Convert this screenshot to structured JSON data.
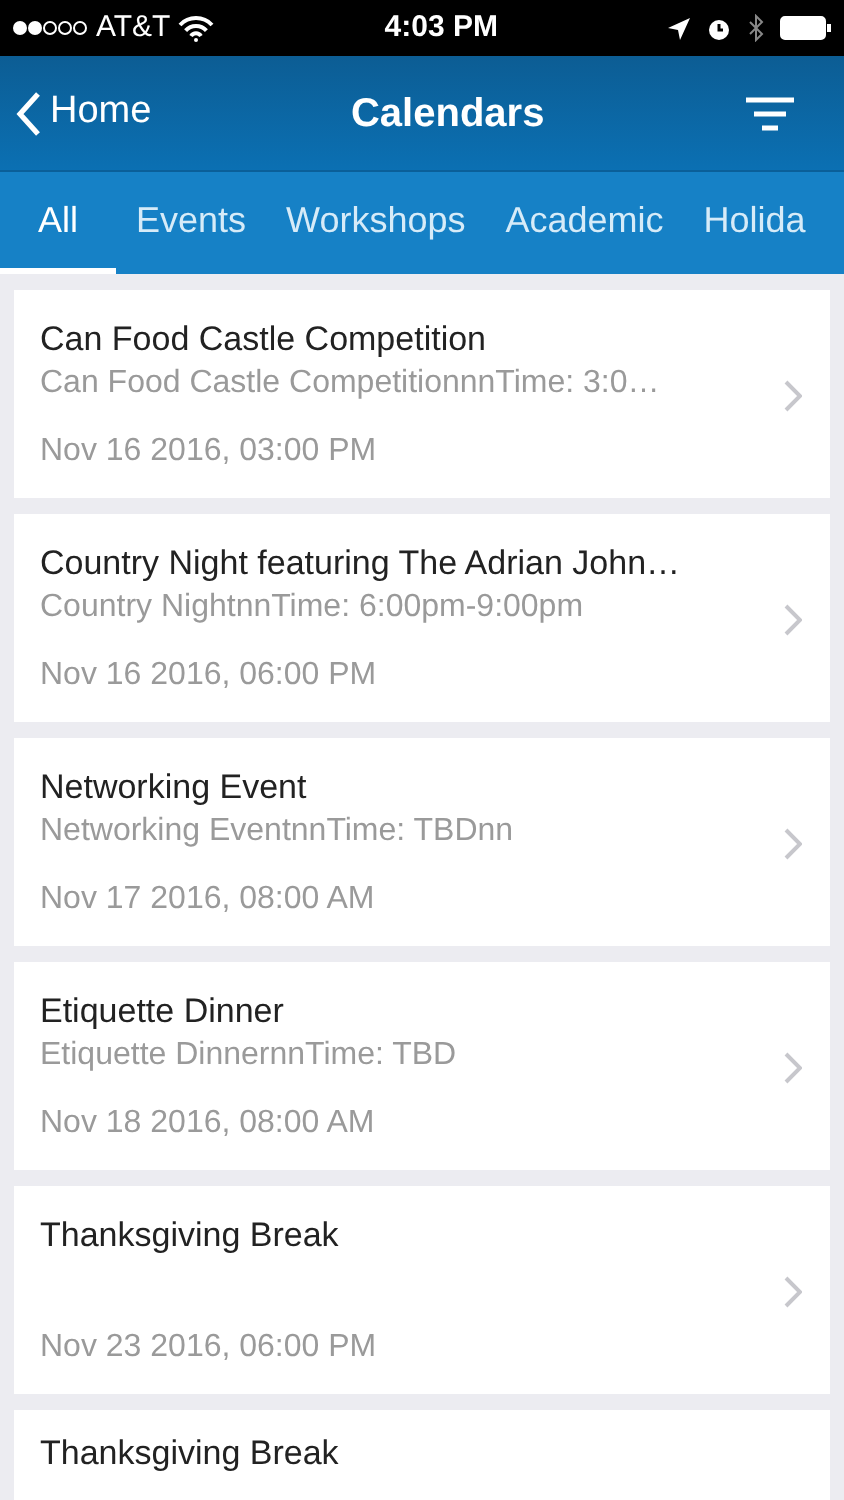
{
  "status_bar": {
    "carrier": "AT&T",
    "time": "4:03 PM"
  },
  "nav_bar": {
    "back": "Home",
    "title": "Calendars"
  },
  "tabs": [
    {
      "label": "All",
      "selected": true
    },
    {
      "label": "Events",
      "selected": false
    },
    {
      "label": "Workshops",
      "selected": false
    },
    {
      "label": "Academic",
      "selected": false
    },
    {
      "label": "Holida",
      "selected": false
    }
  ],
  "events": [
    {
      "title": "Can Food Castle Competition",
      "subtitle": "Can Food Castle CompetitionnnTime: 3:0…",
      "date": "Nov 16 2016, 03:00 PM"
    },
    {
      "title": "Country Night featuring The Adrian John…",
      "subtitle": "Country NightnnTime: 6:00pm-9:00pm",
      "date": "Nov 16 2016, 06:00 PM"
    },
    {
      "title": "Networking Event",
      "subtitle": "Networking EventnnTime: TBDnn",
      "date": "Nov 17 2016, 08:00 AM"
    },
    {
      "title": "Etiquette Dinner",
      "subtitle": "Etiquette DinnernnTime: TBD",
      "date": "Nov 18 2016, 08:00 AM"
    },
    {
      "title": "Thanksgiving Break",
      "date": "Nov 23 2016, 06:00 PM"
    },
    {
      "title": "Thanksgiving Break"
    }
  ]
}
